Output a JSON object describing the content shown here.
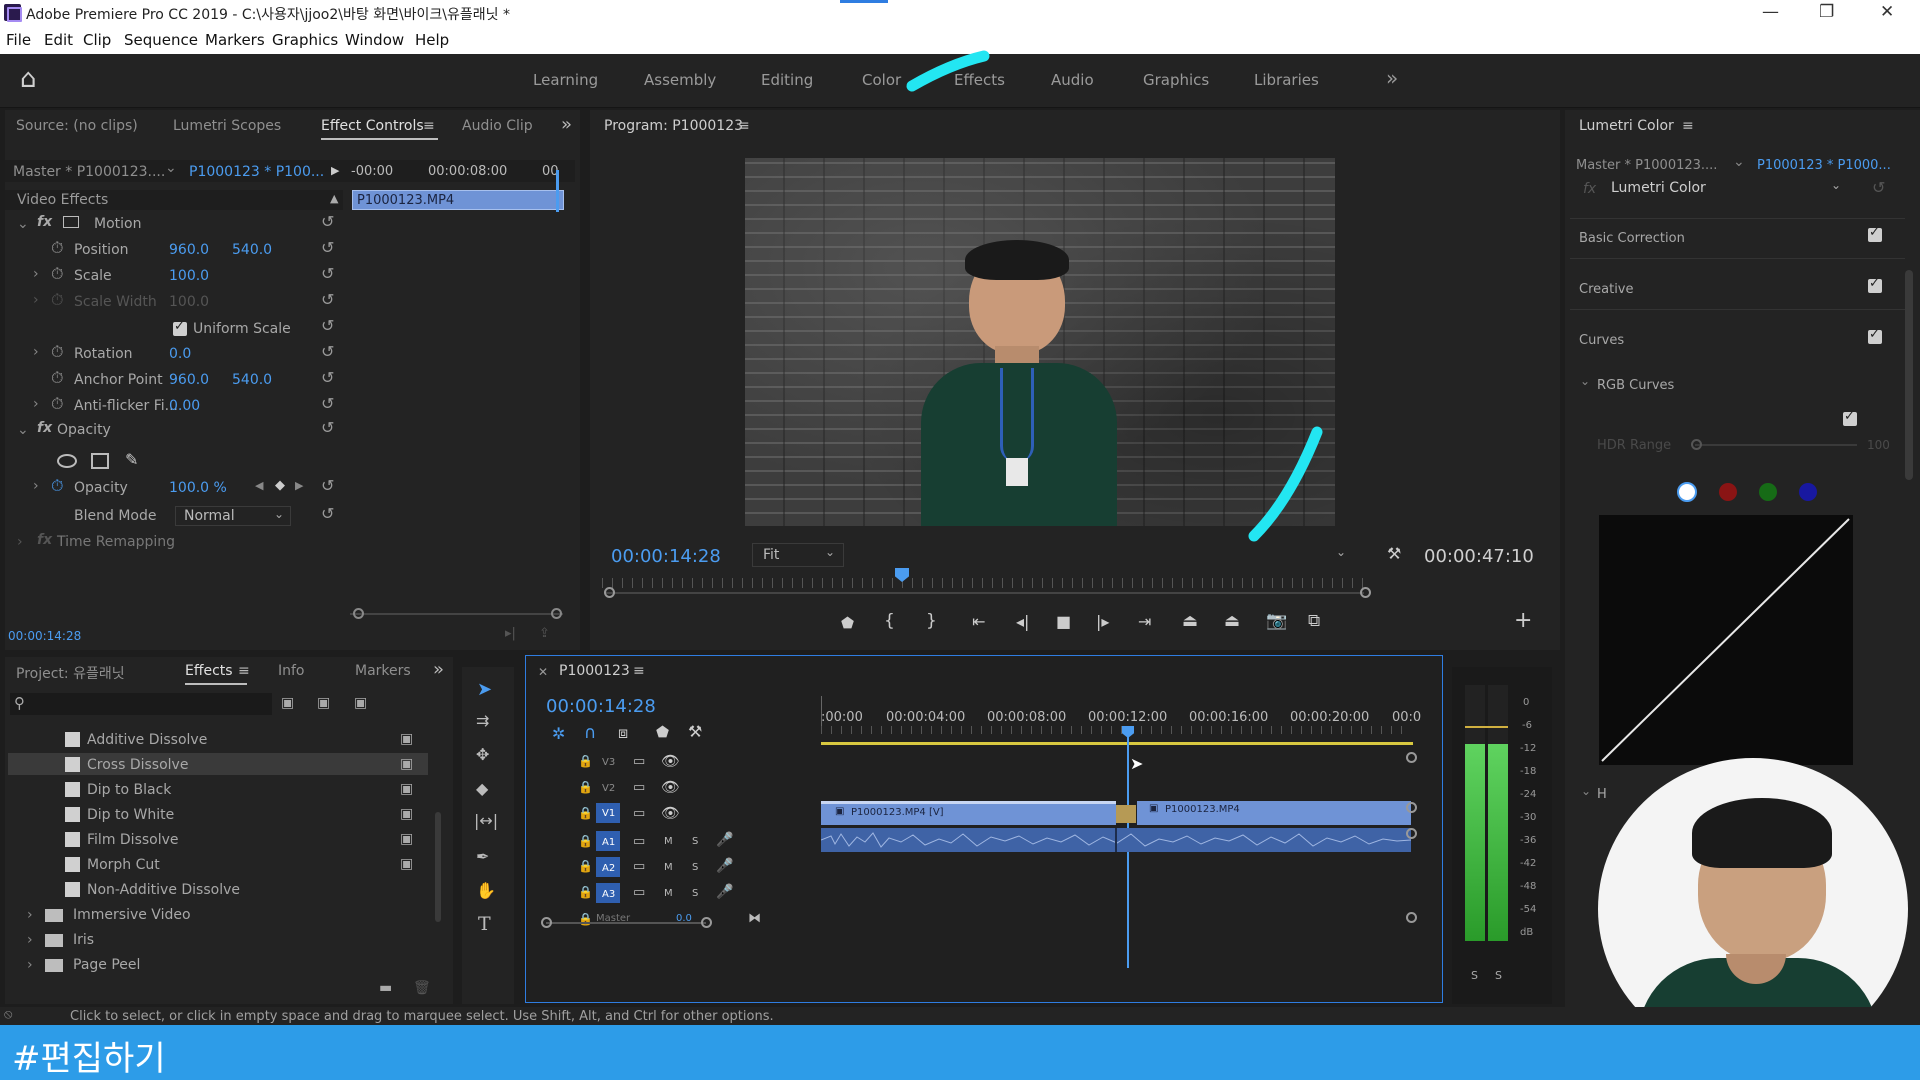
{
  "window": {
    "title": "Adobe Premiere Pro CC 2019 - C:\\사용자\\jjoo2\\바탕 화면\\바이크\\유플래닛 *",
    "min": "—",
    "max": "❐",
    "close": "✕"
  },
  "menu": [
    "File",
    "Edit",
    "Clip",
    "Sequence",
    "Markers",
    "Graphics",
    "Window",
    "Help"
  ],
  "workspaces": [
    "Learning",
    "Assembly",
    "Editing",
    "Color",
    "Effects",
    "Audio",
    "Graphics",
    "Libraries"
  ],
  "workspace_more": "»",
  "icons": {
    "home": "⌂",
    "more": "»",
    "menu": "≡",
    "search": "⚲",
    "reset": "↺",
    "wrench": "🔧",
    "plus": "+",
    "lock": "🔒",
    "eye": "👁",
    "mic": "🎤",
    "cam": "▭"
  },
  "source_panel": {
    "tabs": [
      "Source: (no clips)",
      "Lumetri Scopes",
      "Effect Controls",
      "Audio Clip"
    ],
    "master_label": "Master * P1000123....",
    "clip_link": "P1000123 * P100...",
    "ruler": [
      "-00:00",
      "00:00:08:00",
      "00"
    ],
    "clip_bar": "P1000123.MP4",
    "section": "Video Effects",
    "motion": "Motion",
    "props": [
      {
        "name": "Position",
        "v1": "960.0",
        "v2": "540.0"
      },
      {
        "name": "Scale",
        "v1": "100.0",
        "v2": ""
      },
      {
        "name": "Scale Width",
        "v1": "100.0",
        "v2": ""
      },
      {
        "name": "Uniform Scale",
        "v1": "",
        "v2": ""
      },
      {
        "name": "Rotation",
        "v1": "0.0",
        "v2": ""
      },
      {
        "name": "Anchor Point",
        "v1": "960.0",
        "v2": "540.0"
      },
      {
        "name": "Anti-flicker Fi...",
        "v1": "0.00",
        "v2": ""
      }
    ],
    "opacity_label": "Opacity",
    "opacity_value": "100.0 %",
    "blend_label": "Blend Mode",
    "blend_value": "Normal",
    "time_remap": "Time Remapping",
    "timecode": "00:00:14:28"
  },
  "program": {
    "title": "Program: P1000123",
    "timecode": "00:00:14:28",
    "fit": "Fit",
    "duration": "00:00:47:10"
  },
  "project": {
    "tabs": [
      "Project: 유플래닛",
      "Effects",
      "Info",
      "Markers"
    ],
    "items": [
      "Additive Dissolve",
      "Cross Dissolve",
      "Dip to Black",
      "Dip to White",
      "Film Dissolve",
      "Morph Cut",
      "Non-Additive Dissolve"
    ],
    "folders": [
      "Immersive Video",
      "Iris",
      "Page Peel"
    ]
  },
  "timeline": {
    "title": "P1000123",
    "timecode": "00:00:14:28",
    "ruler": [
      ":00:00",
      "00:00:04:00",
      "00:00:08:00",
      "00:00:12:00",
      "00:00:16:00",
      "00:00:20:00",
      "00:0"
    ],
    "tracks": [
      "V3",
      "V2",
      "V1",
      "A1",
      "A2",
      "A3"
    ],
    "master": "Master",
    "master_val": "0.0",
    "clip_a": "P1000123.MP4 [V]",
    "clip_b": "P1000123.MP4",
    "mute": "M",
    "solo": "S"
  },
  "meter": {
    "scale": [
      "0",
      "-6",
      "-12",
      "-18",
      "-24",
      "-30",
      "-36",
      "-42",
      "-48",
      "-54",
      "dB"
    ],
    "solo": [
      "S",
      "S"
    ]
  },
  "lumetri": {
    "title": "Lumetri Color",
    "master": "Master * P1000123....",
    "clip": "P1000123 * P1000...",
    "fx": "Lumetri Color",
    "sections": [
      "Basic Correction",
      "Creative",
      "Curves"
    ],
    "rgb": "RGB Curves",
    "hdr": "HDR Range",
    "hdr_val": "100",
    "h": "H"
  },
  "status": "Click to select, or click in empty space and drag to marquee select. Use Shift, Alt, and Ctrl for other options.",
  "caption": "#편집하기",
  "colors": {
    "accent": "#4b9cf0",
    "band": "#2d9ce8",
    "stroke": "#23e6f2",
    "clip_v": "#6f93d6",
    "clip_a": "#3f63a6"
  }
}
